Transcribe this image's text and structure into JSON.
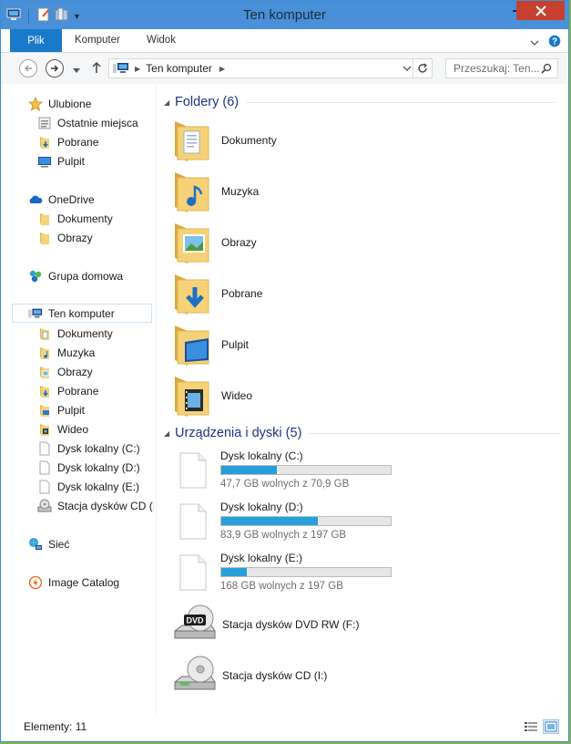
{
  "window": {
    "title": "Ten komputer"
  },
  "ribbon": {
    "tabs": [
      "Plik",
      "Komputer",
      "Widok"
    ]
  },
  "address": {
    "path": "Ten komputer",
    "search_placeholder": "Przeszukaj: Ten..."
  },
  "nav": {
    "favorites": {
      "label": "Ulubione",
      "items": [
        "Ostatnie miejsca",
        "Pobrane",
        "Pulpit"
      ]
    },
    "onedrive": {
      "label": "OneDrive",
      "items": [
        "Dokumenty",
        "Obrazy"
      ]
    },
    "homegroup": {
      "label": "Grupa domowa"
    },
    "thispc": {
      "label": "Ten komputer",
      "items": [
        "Dokumenty",
        "Muzyka",
        "Obrazy",
        "Pobrane",
        "Pulpit",
        "Wideo",
        "Dysk lokalny (C:)",
        "Dysk lokalny (D:)",
        "Dysk lokalny (E:)",
        "Stacja dysków CD (I:"
      ]
    },
    "network": {
      "label": "Sieć"
    },
    "catalog": {
      "label": "Image Catalog"
    }
  },
  "folders": {
    "header": "Foldery (6)",
    "items": [
      "Dokumenty",
      "Muzyka",
      "Obrazy",
      "Pobrane",
      "Pulpit",
      "Wideo"
    ]
  },
  "devices": {
    "header": "Urządzenia i dyski (5)",
    "drives": [
      {
        "name": "Dysk lokalny (C:)",
        "free": "47,7 GB wolnych z 70,9 GB",
        "used_fraction": 0.33
      },
      {
        "name": "Dysk lokalny (D:)",
        "free": "83,9 GB wolnych z 197 GB",
        "used_fraction": 0.57
      },
      {
        "name": "Dysk lokalny (E:)",
        "free": "168 GB wolnych z 197 GB",
        "used_fraction": 0.15
      }
    ],
    "optical": [
      {
        "name": "Stacja dysków DVD RW (F:)",
        "badge": "DVD"
      },
      {
        "name": "Stacja dysków CD (I:)"
      }
    ]
  },
  "status": {
    "text": "Elementy: 11"
  },
  "colors": {
    "accent": "#1979ca",
    "titlebar": "#4a90d8",
    "close": "#c7402f",
    "bar_fill": "#26a0da",
    "folder": "#f1c75a"
  }
}
